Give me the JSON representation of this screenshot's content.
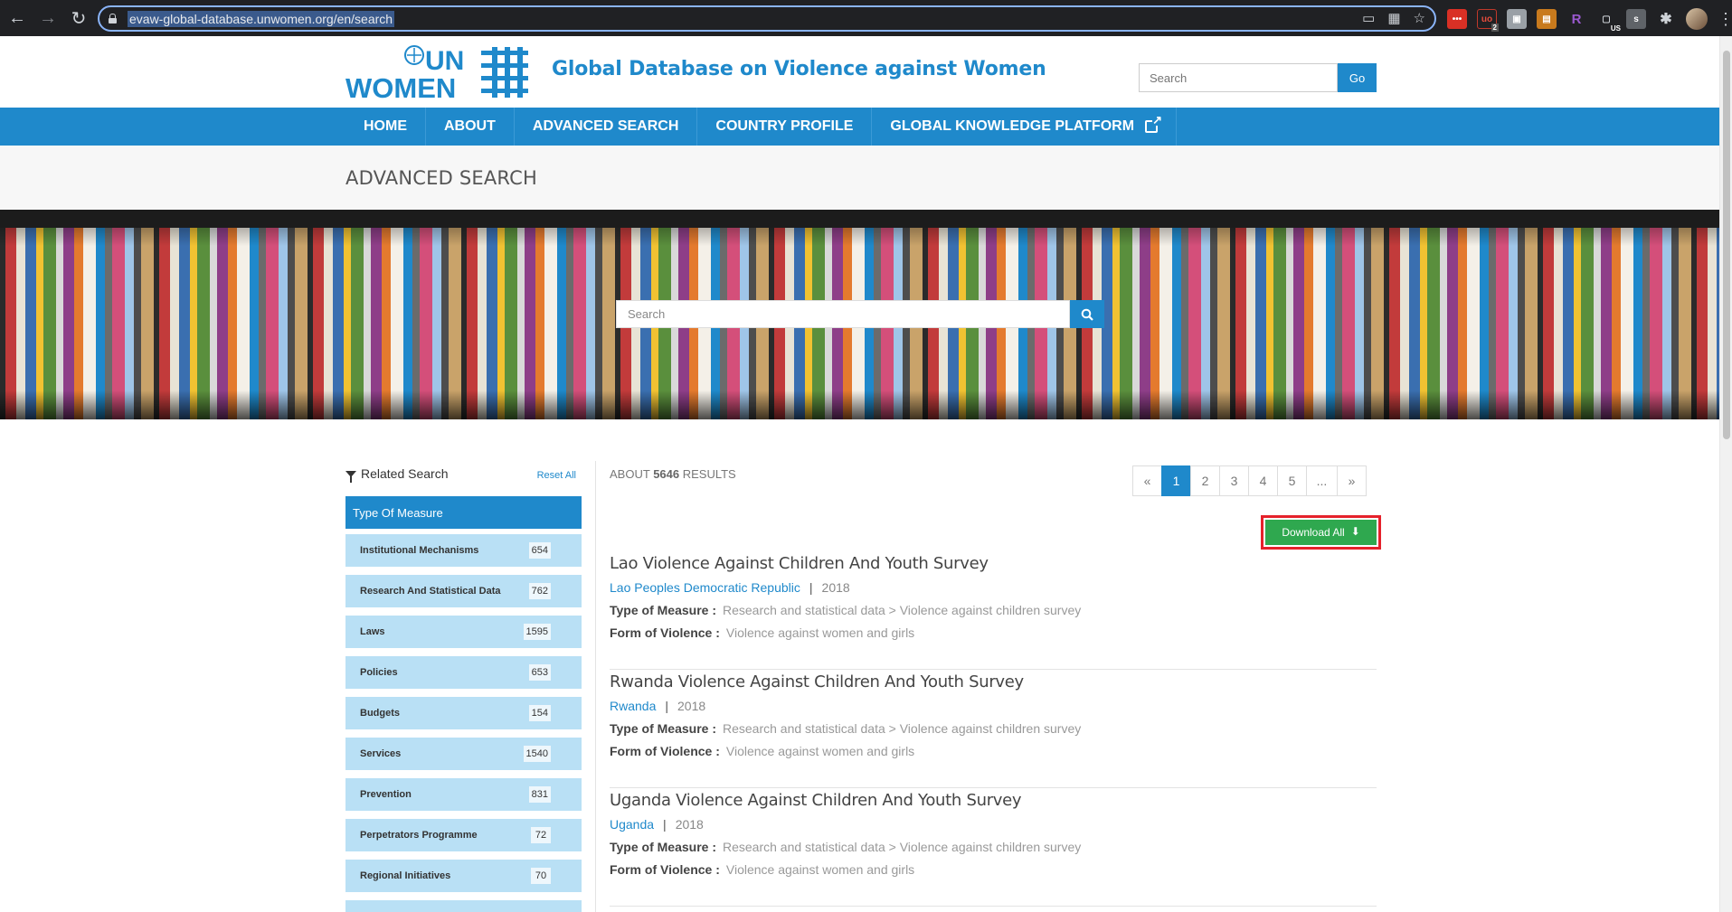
{
  "browser": {
    "url": "evaw-global-database.unwomen.org/en/search",
    "extension_badges": [
      "2",
      "US"
    ]
  },
  "header": {
    "logo_line1": "UN",
    "logo_line2": "WOMEN",
    "site_title": "Global Database on Violence against Women",
    "search_placeholder": "Search",
    "go_label": "Go"
  },
  "nav": {
    "items": [
      "HOME",
      "ABOUT",
      "ADVANCED SEARCH",
      "COUNTRY PROFILE",
      "GLOBAL KNOWLEDGE PLATFORM"
    ]
  },
  "page": {
    "title": "ADVANCED SEARCH",
    "hero_search_placeholder": "Search"
  },
  "sidebar": {
    "heading": "Related Search",
    "reset_label": "Reset All",
    "group_title": "Type Of Measure",
    "facets": [
      {
        "label": "Institutional Mechanisms",
        "count": "654"
      },
      {
        "label": "Research And Statistical Data",
        "count": "762"
      },
      {
        "label": "Laws",
        "count": "1595"
      },
      {
        "label": "Policies",
        "count": "653"
      },
      {
        "label": "Budgets",
        "count": "154"
      },
      {
        "label": "Services",
        "count": "1540"
      },
      {
        "label": "Prevention",
        "count": "831"
      },
      {
        "label": "Perpetrators Programme",
        "count": "72"
      },
      {
        "label": "Regional Initiatives",
        "count": "70"
      }
    ]
  },
  "results": {
    "prefix": "ABOUT",
    "count": "5646",
    "suffix": "RESULTS",
    "pagination": [
      "«",
      "1",
      "2",
      "3",
      "4",
      "5",
      "...",
      "»"
    ],
    "active_page": "1",
    "download_label": "Download All",
    "type_label": "Type of Measure :",
    "form_label": "Form of Violence :",
    "items": [
      {
        "title": "Lao Violence Against Children And Youth Survey",
        "country": "Lao Peoples Democratic Republic",
        "year": "2018",
        "type_of_measure": "Research and statistical data > Violence against children survey",
        "form_of_violence": "Violence against women and girls"
      },
      {
        "title": "Rwanda Violence Against Children And Youth Survey",
        "country": "Rwanda",
        "year": "2018",
        "type_of_measure": "Research and statistical data > Violence against children survey",
        "form_of_violence": "Violence against women and girls"
      },
      {
        "title": "Uganda Violence Against Children And Youth Survey",
        "country": "Uganda",
        "year": "2018",
        "type_of_measure": "Research and statistical data > Violence against children survey",
        "form_of_violence": "Violence against women and girls"
      }
    ]
  },
  "colors": {
    "brand_blue": "#1f89cb",
    "facet_bg": "#b9e0f5",
    "download_green": "#2fa84f",
    "highlight_red": "#e5212b"
  }
}
